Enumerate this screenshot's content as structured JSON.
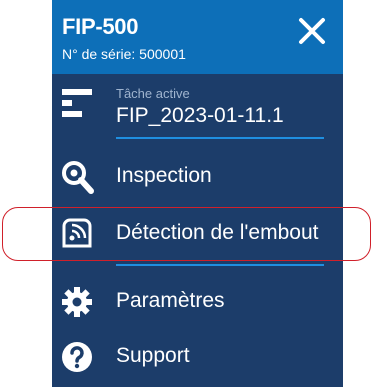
{
  "header": {
    "title": "FIP-500",
    "serial": "N° de série: 500001"
  },
  "active_task": {
    "label": "Tâche active",
    "name": "FIP_2023-01-11.1"
  },
  "menu": {
    "items": [
      {
        "label": "Inspection",
        "icon": "magnifier-icon"
      },
      {
        "label": "Détection de l'embout",
        "icon": "tip-detection-icon"
      },
      {
        "label": "Paramètres",
        "icon": "gear-icon"
      },
      {
        "label": "Support",
        "icon": "question-icon"
      }
    ]
  },
  "colors": {
    "header": "#0d6fb8",
    "panel": "#1c3d6a",
    "divider": "#1f8fe0",
    "highlight": "#d0202a"
  }
}
